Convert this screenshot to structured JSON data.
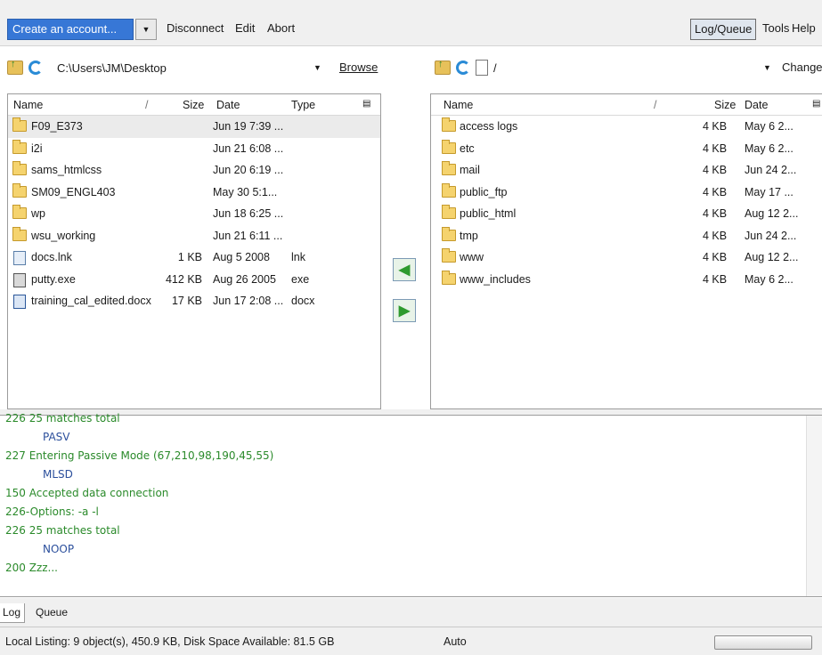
{
  "toolbar": {
    "account_select": "Create an account...",
    "disconnect": "Disconnect",
    "edit": "Edit",
    "abort": "Abort",
    "log_queue": "Log/Queue",
    "tools": "Tools",
    "help": "Help"
  },
  "local": {
    "path": "C:\\Users\\JM\\Desktop",
    "browse_label": "Browse",
    "columns": {
      "name": "Name",
      "size": "Size",
      "date": "Date",
      "type": "Type"
    },
    "files": [
      {
        "name": "F09_E373",
        "size": "",
        "date": "Jun 19 7:39 ...",
        "type": "",
        "kind": "folder"
      },
      {
        "name": "i2i",
        "size": "",
        "date": "Jun 21 6:08 ...",
        "type": "",
        "kind": "folder"
      },
      {
        "name": "sams_htmlcss",
        "size": "",
        "date": "Jun 20 6:19 ...",
        "type": "",
        "kind": "folder"
      },
      {
        "name": "SM09_ENGL403",
        "size": "",
        "date": "May 30 5:1...",
        "type": "",
        "kind": "folder"
      },
      {
        "name": "wp",
        "size": "",
        "date": "Jun 18 6:25 ...",
        "type": "",
        "kind": "folder"
      },
      {
        "name": "wsu_working",
        "size": "",
        "date": "Jun 21 6:11 ...",
        "type": "",
        "kind": "folder"
      },
      {
        "name": "docs.lnk",
        "size": "1 KB",
        "date": "Aug 5 2008",
        "type": "lnk",
        "kind": "link"
      },
      {
        "name": "putty.exe",
        "size": "412 KB",
        "date": "Aug 26 2005",
        "type": "exe",
        "kind": "exe"
      },
      {
        "name": "training_cal_edited.docx",
        "size": "17 KB",
        "date": "Jun 17 2:08 ...",
        "type": "docx",
        "kind": "docx"
      }
    ]
  },
  "remote": {
    "path": "/",
    "change_label": "Change",
    "columns": {
      "name": "Name",
      "size": "Size",
      "date": "Date"
    },
    "files": [
      {
        "name": "access logs",
        "size": "4 KB",
        "date": "May 6 2..."
      },
      {
        "name": "etc",
        "size": "4 KB",
        "date": "May 6 2..."
      },
      {
        "name": "mail",
        "size": "4 KB",
        "date": "Jun 24 2..."
      },
      {
        "name": "public_ftp",
        "size": "4 KB",
        "date": "May 17 ..."
      },
      {
        "name": "public_html",
        "size": "4 KB",
        "date": "Aug 12 2..."
      },
      {
        "name": "tmp",
        "size": "4 KB",
        "date": "Jun 24 2..."
      },
      {
        "name": "www",
        "size": "4 KB",
        "date": "Aug 12 2..."
      },
      {
        "name": "www_includes",
        "size": "4 KB",
        "date": "May 6 2..."
      }
    ]
  },
  "log": {
    "lines": [
      {
        "text": "226 25 matches total",
        "kind": "resp"
      },
      {
        "text": "PASV",
        "kind": "cmd"
      },
      {
        "text": "227 Entering Passive Mode (67,210,98,190,45,55)",
        "kind": "resp"
      },
      {
        "text": "MLSD",
        "kind": "cmd"
      },
      {
        "text": "150 Accepted data connection",
        "kind": "resp"
      },
      {
        "text": "226-Options: -a -l",
        "kind": "resp"
      },
      {
        "text": "226 25 matches total",
        "kind": "resp"
      },
      {
        "text": "NOOP",
        "kind": "cmd"
      },
      {
        "text": "200 Zzz...",
        "kind": "resp"
      }
    ]
  },
  "tabs": {
    "log": "Log",
    "queue": "Queue"
  },
  "status": {
    "local_listing": "Local Listing: 9 object(s), 450.9 KB, Disk Space Available: 81.5 GB",
    "mode": "Auto"
  }
}
